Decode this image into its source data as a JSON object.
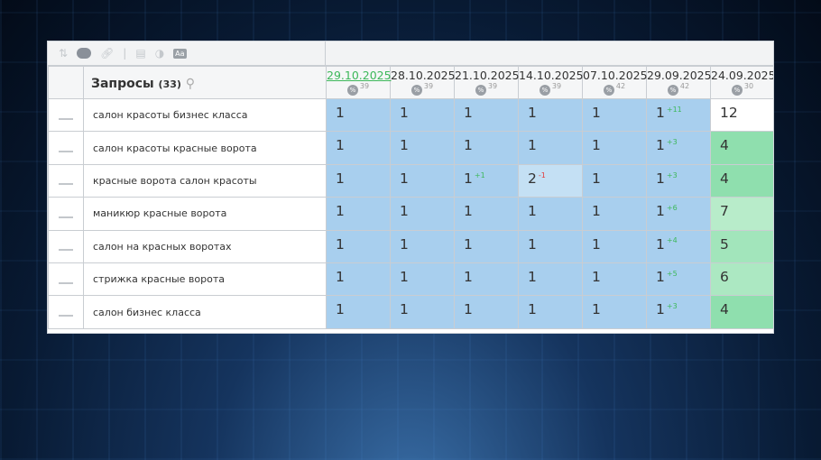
{
  "toolbar": {
    "icons": [
      "sort-icon",
      "toggle-icon",
      "link-icon",
      "list-icon",
      "contrast-icon",
      "font-icon"
    ],
    "font_label": "Aa"
  },
  "header": {
    "title": "Запросы",
    "count": "(33)"
  },
  "dates": [
    {
      "date": "29.10.2025",
      "pct": "39",
      "current": true
    },
    {
      "date": "28.10.2025",
      "pct": "39"
    },
    {
      "date": "21.10.2025",
      "pct": "39"
    },
    {
      "date": "14.10.2025",
      "pct": "39"
    },
    {
      "date": "07.10.2025",
      "pct": "42"
    },
    {
      "date": "29.09.2025",
      "pct": "42"
    },
    {
      "date": "24.09.2025",
      "pct": "30"
    }
  ],
  "pct_symbol": "%",
  "rows": [
    {
      "kw": "салон красоты бизнес класса",
      "v": [
        [
          "1"
        ],
        [
          "1"
        ],
        [
          "1"
        ],
        [
          "1"
        ],
        [
          "1"
        ],
        [
          "1",
          "+11"
        ],
        [
          "12"
        ]
      ],
      "last": "#ffffff"
    },
    {
      "kw": "салон красоты красные ворота",
      "v": [
        [
          "1"
        ],
        [
          "1"
        ],
        [
          "1"
        ],
        [
          "1"
        ],
        [
          "1"
        ],
        [
          "1",
          "+3"
        ],
        [
          "4"
        ]
      ],
      "last": "#8fdfae"
    },
    {
      "kw": "красные ворота салон красоты",
      "v": [
        [
          "1"
        ],
        [
          "1"
        ],
        [
          "1",
          "+1"
        ],
        [
          "2",
          "-1"
        ],
        [
          "1"
        ],
        [
          "1",
          "+3"
        ],
        [
          "4"
        ]
      ],
      "last": "#8fdfae"
    },
    {
      "kw": "маникюр красные ворота",
      "v": [
        [
          "1"
        ],
        [
          "1"
        ],
        [
          "1"
        ],
        [
          "1"
        ],
        [
          "1"
        ],
        [
          "1",
          "+6"
        ],
        [
          "7"
        ]
      ],
      "last": "#b8ecca"
    },
    {
      "kw": "салон на красных воротах",
      "v": [
        [
          "1"
        ],
        [
          "1"
        ],
        [
          "1"
        ],
        [
          "1"
        ],
        [
          "1"
        ],
        [
          "1",
          "+4"
        ],
        [
          "5"
        ]
      ],
      "last": "#a2e5bb"
    },
    {
      "kw": "стрижка красные ворота",
      "v": [
        [
          "1"
        ],
        [
          "1"
        ],
        [
          "1"
        ],
        [
          "1"
        ],
        [
          "1"
        ],
        [
          "1",
          "+5"
        ],
        [
          "6"
        ]
      ],
      "last": "#ace8c2"
    },
    {
      "kw": "салон бизнес класса",
      "v": [
        [
          "1"
        ],
        [
          "1"
        ],
        [
          "1"
        ],
        [
          "1"
        ],
        [
          "1"
        ],
        [
          "1",
          "+3"
        ],
        [
          "4"
        ]
      ],
      "last": "#8fdfae"
    }
  ]
}
